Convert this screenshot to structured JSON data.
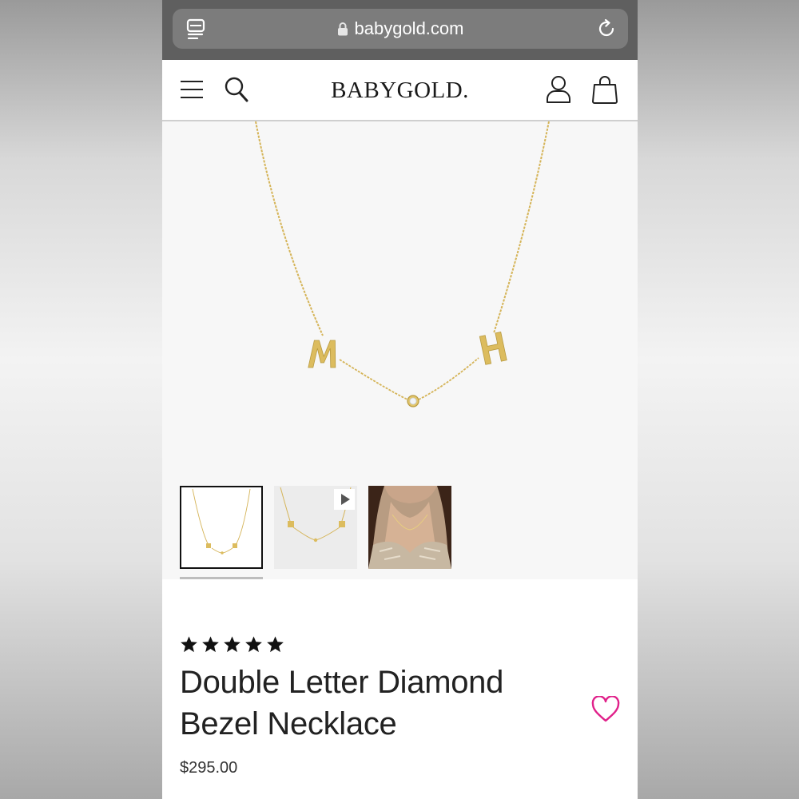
{
  "browser": {
    "url": "babygold.com",
    "icons": {
      "tabs": "tabs-icon",
      "lock": "lock-icon",
      "reload": "reload-icon"
    }
  },
  "header": {
    "logo": "BABYGOLD.",
    "icons": [
      "menu-icon",
      "search-icon",
      "user-icon",
      "shopping-bag-icon"
    ]
  },
  "gallery": {
    "main_image": "gold necklace with letters M and H and a diamond bezel",
    "thumbnails": [
      {
        "label": "necklace-front",
        "active": true
      },
      {
        "label": "necklace-video",
        "active": false,
        "has_play_icon": true
      },
      {
        "label": "model-wearing-necklace",
        "active": false
      }
    ]
  },
  "product": {
    "rating": 5,
    "rating_max": 5,
    "title": "Double Letter Diamond Bezel Necklace",
    "price": "$295.00"
  },
  "colors": {
    "browser_bar": "#5f5f5f",
    "url_pill": "#7c7c7c",
    "gold": "#d8b85a",
    "heart": "#e0218a",
    "stage": "#f7f7f7"
  }
}
